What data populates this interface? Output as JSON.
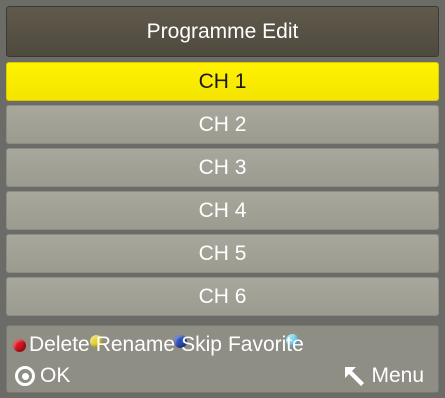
{
  "title": "Programme Edit",
  "channels": [
    {
      "label": "CH 1",
      "selected": true
    },
    {
      "label": "CH 2",
      "selected": false
    },
    {
      "label": "CH 3",
      "selected": false
    },
    {
      "label": "CH 4",
      "selected": false
    },
    {
      "label": "CH 5",
      "selected": false
    },
    {
      "label": "CH 6",
      "selected": false
    }
  ],
  "footer": {
    "keys": [
      {
        "label": "Delete",
        "color": "#d8141c",
        "icon": "red-button-icon"
      },
      {
        "label": "Rename",
        "color": "#e8d53a",
        "icon": "yellow-button-icon"
      },
      {
        "label": "Skip",
        "color": "#2a4fb8",
        "icon": "blue-button-icon"
      },
      {
        "label": "Favorite",
        "color": "#7fd8f0",
        "icon": "cyan-button-icon"
      }
    ],
    "ok_label": "OK",
    "menu_label": "Menu"
  },
  "colors": {
    "selected_row": "#fff200",
    "row": "#a3a297",
    "title_bar": "#58524a",
    "footer": "#8f8e84"
  }
}
